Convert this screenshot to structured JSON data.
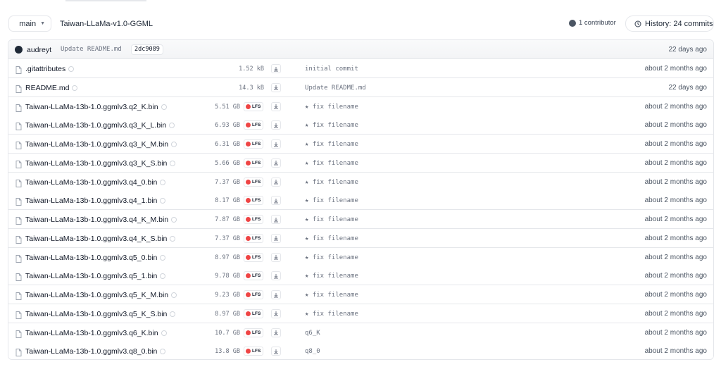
{
  "header": {
    "branch": "main",
    "repo_path": "Taiwan-LLaMa-v1.0-GGML",
    "contributors": "1 contributor",
    "history": "History: 24 commits"
  },
  "last_commit": {
    "author": "audreyt",
    "message": "Update README.md",
    "hash": "2dc9089",
    "date": "22 days ago"
  },
  "files": [
    {
      "name": ".gitattributes",
      "size": "1.52 kB",
      "lfs": false,
      "commit": "initial commit",
      "date": "about 2 months ago"
    },
    {
      "name": "README.md",
      "size": "14.3 kB",
      "lfs": false,
      "commit": "Update README.md",
      "date": "22 days ago"
    },
    {
      "name": "Taiwan-LLaMa-13b-1.0.ggmlv3.q2_K.bin",
      "size": "5.51 GB",
      "lfs": true,
      "commit": "★ fix filename",
      "date": "about 2 months ago"
    },
    {
      "name": "Taiwan-LLaMa-13b-1.0.ggmlv3.q3_K_L.bin",
      "size": "6.93 GB",
      "lfs": true,
      "commit": "★ fix filename",
      "date": "about 2 months ago"
    },
    {
      "name": "Taiwan-LLaMa-13b-1.0.ggmlv3.q3_K_M.bin",
      "size": "6.31 GB",
      "lfs": true,
      "commit": "★ fix filename",
      "date": "about 2 months ago"
    },
    {
      "name": "Taiwan-LLaMa-13b-1.0.ggmlv3.q3_K_S.bin",
      "size": "5.66 GB",
      "lfs": true,
      "commit": "★ fix filename",
      "date": "about 2 months ago"
    },
    {
      "name": "Taiwan-LLaMa-13b-1.0.ggmlv3.q4_0.bin",
      "size": "7.37 GB",
      "lfs": true,
      "commit": "★ fix filename",
      "date": "about 2 months ago"
    },
    {
      "name": "Taiwan-LLaMa-13b-1.0.ggmlv3.q4_1.bin",
      "size": "8.17 GB",
      "lfs": true,
      "commit": "★ fix filename",
      "date": "about 2 months ago"
    },
    {
      "name": "Taiwan-LLaMa-13b-1.0.ggmlv3.q4_K_M.bin",
      "size": "7.87 GB",
      "lfs": true,
      "commit": "★ fix filename",
      "date": "about 2 months ago"
    },
    {
      "name": "Taiwan-LLaMa-13b-1.0.ggmlv3.q4_K_S.bin",
      "size": "7.37 GB",
      "lfs": true,
      "commit": "★ fix filename",
      "date": "about 2 months ago"
    },
    {
      "name": "Taiwan-LLaMa-13b-1.0.ggmlv3.q5_0.bin",
      "size": "8.97 GB",
      "lfs": true,
      "commit": "★ fix filename",
      "date": "about 2 months ago"
    },
    {
      "name": "Taiwan-LLaMa-13b-1.0.ggmlv3.q5_1.bin",
      "size": "9.78 GB",
      "lfs": true,
      "commit": "★ fix filename",
      "date": "about 2 months ago"
    },
    {
      "name": "Taiwan-LLaMa-13b-1.0.ggmlv3.q5_K_M.bin",
      "size": "9.23 GB",
      "lfs": true,
      "commit": "★ fix filename",
      "date": "about 2 months ago"
    },
    {
      "name": "Taiwan-LLaMa-13b-1.0.ggmlv3.q5_K_S.bin",
      "size": "8.97 GB",
      "lfs": true,
      "commit": "★ fix filename",
      "date": "about 2 months ago"
    },
    {
      "name": "Taiwan-LLaMa-13b-1.0.ggmlv3.q6_K.bin",
      "size": "10.7 GB",
      "lfs": true,
      "commit": "q6_K",
      "date": "about 2 months ago"
    },
    {
      "name": "Taiwan-LLaMa-13b-1.0.ggmlv3.q8_0.bin",
      "size": "13.8 GB",
      "lfs": true,
      "commit": "q8_0",
      "date": "about 2 months ago"
    }
  ],
  "labels": {
    "lfs_badge": "LFS"
  },
  "icons": [
    "branch-icon",
    "caret-down-icon",
    "history-icon",
    "file-icon",
    "download-icon",
    "lfs-icon",
    "safe-file-icon"
  ]
}
